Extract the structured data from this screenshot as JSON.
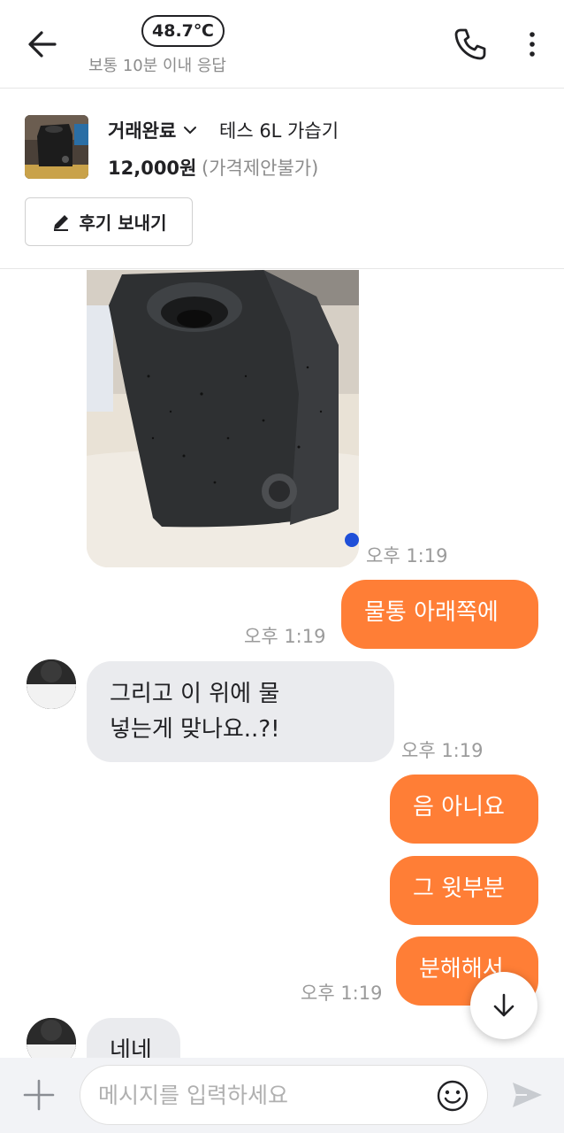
{
  "header": {
    "manner_temp": "48.7℃",
    "response_time": "보통 10분 이내 응답"
  },
  "product": {
    "status": "거래완료",
    "name": "테스 6L 가습기",
    "price": "12,000원",
    "price_note": "(가격제안불가)",
    "review_button": "후기 보내기"
  },
  "messages": {
    "photo_time": "오후 1:19",
    "m1_text": "물통 아래쪽에",
    "m1_time": "오후 1:19",
    "m2_line1": "그리고 이 위에 물",
    "m2_line2": "넣는게 맞나요..?!",
    "m2_time": "오후 1:19",
    "m3_text": "음 아니요",
    "m4_text": "그 윗부분",
    "m5_text": "분해해서",
    "m5_time": "오후 1:19",
    "m6_text": "네네"
  },
  "input": {
    "placeholder": "메시지를 입력하세요"
  },
  "colors": {
    "accent": "#ff7e36",
    "incoming_bubble": "#eaebee",
    "muted_text": "#9b9b9b"
  },
  "icons": [
    "back-arrow-icon",
    "phone-icon",
    "more-vertical-icon",
    "chevron-down-icon",
    "pencil-icon",
    "arrow-down-icon",
    "plus-icon",
    "emoji-icon",
    "send-icon"
  ]
}
